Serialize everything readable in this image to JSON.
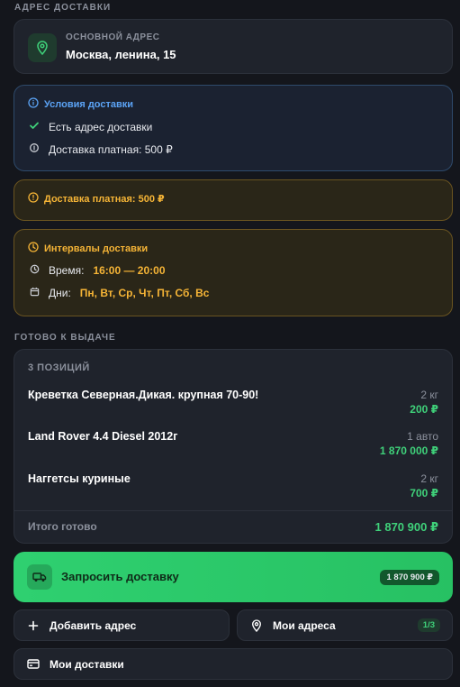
{
  "delivery_address": {
    "section_title": "АДРЕС ДОСТАВКИ",
    "label": "ОСНОВНОЙ АДРЕС",
    "value": "Москва, ленина, 15",
    "icon": "map-pin-icon"
  },
  "conditions": {
    "title": "Условия доставки",
    "rows": [
      {
        "icon": "check-icon",
        "text": "Есть адрес доставки"
      },
      {
        "icon": "coin-icon",
        "text": "Доставка платная: 500 ₽"
      }
    ]
  },
  "paid_notice": {
    "text": "Доставка платная: 500 ₽"
  },
  "intervals": {
    "title": "Интервалы доставки",
    "time_label": "Время:",
    "time_value": "16:00 — 20:00",
    "days_label": "Дни:",
    "days_value": "Пн, Вт, Ср, Чт, Пт, Сб, Вс"
  },
  "ready": {
    "section_title": "ГОТОВО К ВЫДАЧЕ",
    "count_label": "3 ПОЗИЦИЙ",
    "items": [
      {
        "name": "Креветка Северная.Дикая. крупная 70-90!",
        "qty": "2 кг",
        "price": "200 ₽"
      },
      {
        "name": "Land Rover 4.4 Diesel 2012г",
        "qty": "1 авто",
        "price": "1 870 000 ₽"
      },
      {
        "name": "Наггетсы куриные",
        "qty": "2 кг",
        "price": "700 ₽"
      }
    ],
    "total_label": "Итого готово",
    "total_value": "1 870 900 ₽"
  },
  "request_button": {
    "label": "Запросить доставку",
    "price": "1 870 900 ₽"
  },
  "actions": {
    "add_address": "Добавить адрес",
    "my_addresses": "Мои адреса",
    "my_addresses_count": "1/3",
    "my_deliveries": "Мои доставки"
  },
  "colors": {
    "background": "#14161c",
    "accent_green": "#2fd070",
    "info_blue": "#5ba3f5",
    "warning_amber": "#f5b436"
  }
}
